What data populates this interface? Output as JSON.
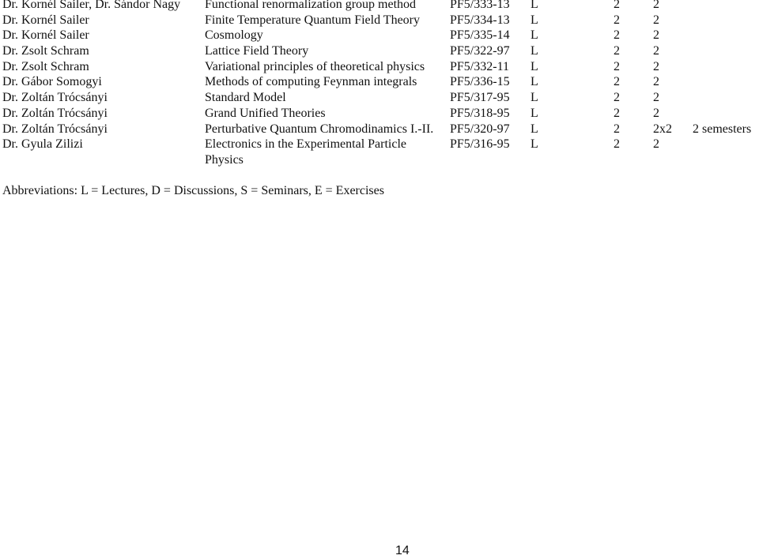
{
  "courses": [
    {
      "name": "Dr. Kornél Sailer, Dr. Sándor Nagy",
      "course": "Functional renormalization group method",
      "code": "PF5/333-13",
      "type": "L",
      "hours": "2",
      "credits": "2",
      "note": ""
    },
    {
      "name": "Dr. Kornél Sailer",
      "course": "Finite Temperature Quantum Field Theory",
      "code": "PF5/334-13",
      "type": "L",
      "hours": "2",
      "credits": "2",
      "note": ""
    },
    {
      "name": "Dr. Kornél Sailer",
      "course": "Cosmology",
      "code": "PF5/335-14",
      "type": "L",
      "hours": "2",
      "credits": "2",
      "note": ""
    },
    {
      "name": "Dr. Zsolt Schram",
      "course": "Lattice Field Theory",
      "code": "PF5/322-97",
      "type": "L",
      "hours": "2",
      "credits": "2",
      "note": ""
    },
    {
      "name": "Dr. Zsolt Schram",
      "course": "Variational principles of theoretical physics",
      "code": "PF5/332-11",
      "type": "L",
      "hours": "2",
      "credits": "2",
      "note": ""
    },
    {
      "name": "Dr. Gábor Somogyi",
      "course": "Methods of computing Feynman integrals",
      "code": "PF5/336-15",
      "type": "L",
      "hours": "2",
      "credits": "2",
      "note": ""
    },
    {
      "name": "Dr. Zoltán Trócsányi",
      "course": "Standard Model",
      "code": "PF5/317-95",
      "type": "L",
      "hours": "2",
      "credits": "2",
      "note": ""
    },
    {
      "name": "Dr. Zoltán Trócsányi",
      "course": "Grand Unified Theories",
      "code": "PF5/318-95",
      "type": "L",
      "hours": "2",
      "credits": "2",
      "note": ""
    },
    {
      "name": "Dr. Zoltán Trócsányi",
      "course": "Perturbative Quantum Chromodinamics I.-II.",
      "code": "PF5/320-97",
      "type": "L",
      "hours": "2",
      "credits": "2x2",
      "note": "2 semesters"
    },
    {
      "name": "Dr. Gyula Zilizi",
      "course": "Electronics in the Experimental Particle Physics",
      "code": "PF5/316-95",
      "type": "L",
      "hours": "2",
      "credits": "2",
      "note": ""
    }
  ],
  "abbreviations": "Abbreviations: L = Lectures, D = Discussions, S = Seminars, E = Exercises",
  "page_number": "14"
}
